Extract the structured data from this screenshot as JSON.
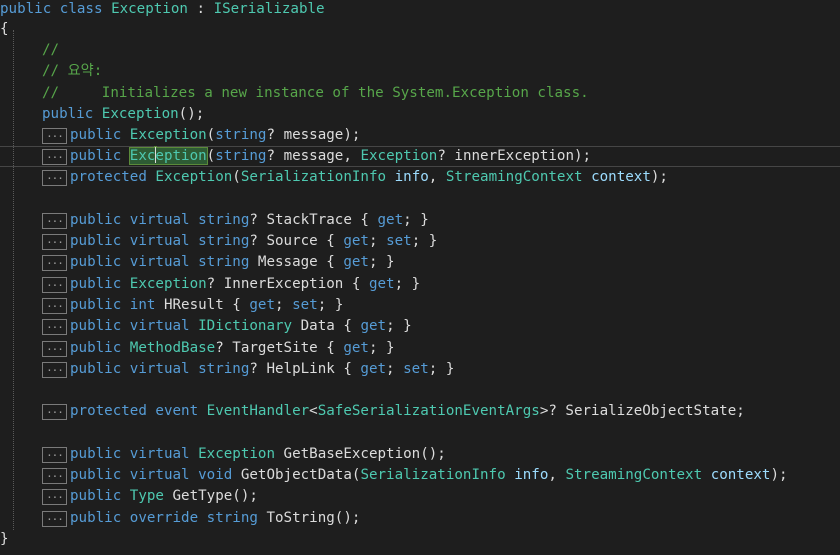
{
  "code": {
    "class_decl": {
      "public": "public",
      "class": "class",
      "name": "Exception",
      "colon": " : ",
      "base": "ISerializable"
    },
    "open_brace": "{",
    "close_brace": "}",
    "comments": {
      "line1": "//",
      "line2": "// 요약:",
      "line3": "//     Initializes a new instance of the System.Exception class."
    },
    "ctor_default": {
      "public": "public",
      "name": "Exception",
      "rest": "();"
    },
    "collapsed_marker": "...",
    "members": {
      "ctor_message": [
        "public",
        "Exception",
        "(",
        "string",
        "? ",
        "message",
        ");"
      ],
      "ctor_inner": [
        "public",
        "Exc",
        "eption",
        "(",
        "string",
        "? ",
        "message",
        ", ",
        "Exception",
        "? ",
        "innerException",
        ");"
      ],
      "ctor_protected": [
        "protected",
        "Exception",
        "(",
        "SerializationInfo",
        " ",
        "info",
        ", ",
        "StreamingContext",
        " ",
        "context",
        ");"
      ],
      "stacktrace": [
        "public virtual ",
        "string",
        "? StackTrace { ",
        "get",
        "; }"
      ],
      "source": [
        "public virtual ",
        "string",
        "? Source { ",
        "get",
        "; ",
        "set",
        "; }"
      ],
      "message": [
        "public virtual ",
        "string",
        " Message { ",
        "get",
        "; }"
      ],
      "innerexception": [
        "public ",
        "Exception",
        "? InnerException { ",
        "get",
        "; }"
      ],
      "hresult": [
        "public ",
        "int",
        " HResult { ",
        "get",
        "; ",
        "set",
        "; }"
      ],
      "data": [
        "public virtual ",
        "IDictionary",
        " Data { ",
        "get",
        "; }"
      ],
      "targetsite": [
        "public ",
        "MethodBase",
        "? TargetSite { ",
        "get",
        "; }"
      ],
      "helplink": [
        "public virtual ",
        "string",
        "? HelpLink { ",
        "get",
        "; ",
        "set",
        "; }"
      ],
      "event": [
        "protected event ",
        "EventHandler",
        "<",
        "SafeSerializationEventArgs",
        ">? SerializeObjectState;"
      ],
      "getbase": [
        "public virtual ",
        "Exception",
        " GetBaseException();"
      ],
      "getobjectdata": [
        "public virtual void ",
        "GetObjectData(",
        "SerializationInfo",
        " ",
        "info",
        ", ",
        "StreamingContext",
        " ",
        "context",
        ");"
      ],
      "gettype": [
        "public ",
        "Type",
        " GetType();"
      ],
      "tostring": [
        "public override ",
        "string",
        " ToString();"
      ]
    }
  },
  "colors": {
    "background": "#1e1e1e",
    "keyword": "#569cd6",
    "type": "#4ec9b0",
    "comment": "#57a64a",
    "text": "#dcdcdc",
    "parameter": "#9cdcfe",
    "highlight": "#2e5b34"
  }
}
